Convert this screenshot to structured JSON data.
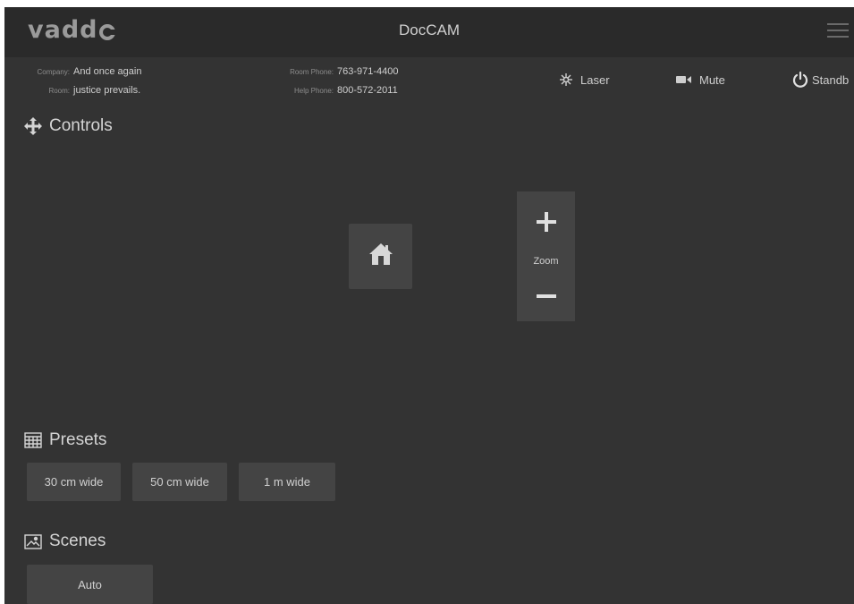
{
  "header": {
    "logo": "vadd",
    "title": "DocCAM",
    "menu_icon": "hamburger-menu-icon"
  },
  "info": {
    "company_label": "Company:",
    "company_value": "And once again",
    "room_label": "Room:",
    "room_value": "justice prevails.",
    "room_phone_label": "Room Phone:",
    "room_phone_value": "763-971-4400",
    "help_phone_label": "Help Phone:",
    "help_phone_value": "800-572-2011"
  },
  "actions": {
    "laser": "Laser",
    "mute": "Mute",
    "standby": "Standb"
  },
  "controls": {
    "title": "Controls",
    "home_icon": "home-icon",
    "zoom_label": "Zoom"
  },
  "presets": {
    "title": "Presets",
    "items": [
      "30 cm wide",
      "50 cm wide",
      "1 m wide"
    ]
  },
  "scenes": {
    "title": "Scenes",
    "items": [
      "Auto"
    ]
  },
  "colors": {
    "background": "#333333",
    "header": "#2a2a2a",
    "button": "#444444",
    "text": "#d6d6d6"
  }
}
